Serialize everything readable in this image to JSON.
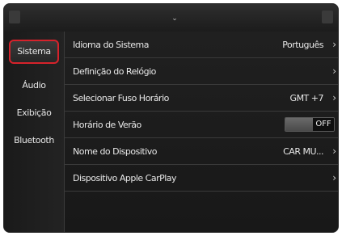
{
  "header": {
    "pull_icon": "chevron-down-icon",
    "glyph": "⌄"
  },
  "sidebar": {
    "items": [
      {
        "label": "Sistema",
        "active": true
      },
      {
        "label": "Áudio"
      },
      {
        "label": "Exibição"
      },
      {
        "label": "Bluetooth"
      }
    ]
  },
  "settings": {
    "rows": [
      {
        "label": "Idioma do Sistema",
        "value": "Português",
        "chevron": "›"
      },
      {
        "label": "Definição do Relógio",
        "value": "",
        "chevron": "›"
      },
      {
        "label": "Selecionar Fuso Horário",
        "value": "GMT +7",
        "chevron": "›"
      },
      {
        "label": "Horário de Verão",
        "toggle": "OFF"
      },
      {
        "label": "Nome do Dispositivo",
        "value": "CAR MU...",
        "chevron": "›"
      },
      {
        "label": "Dispositivo Apple CarPlay",
        "value": "",
        "chevron": "›"
      }
    ]
  },
  "colors": {
    "accent_red": "#d6222b",
    "background": "#151515"
  }
}
